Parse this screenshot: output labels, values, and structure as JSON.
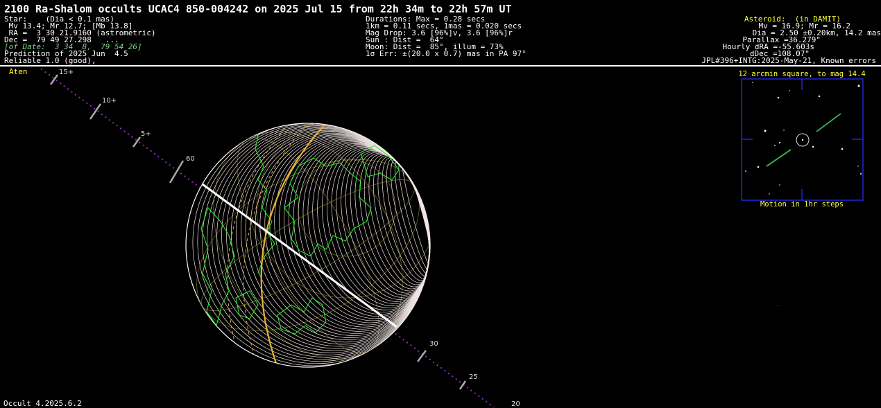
{
  "title": "2100 Ra-Shalom occults UCAC4 850-004242 on 2025 Jul 15 from 22h 34m to 22h 57m UT",
  "star_block": [
    "Star:    (Dia < 0.1 mas)",
    " Mv 13.4; Mr 12.7; [Mb 13.8]",
    " RA =  3 30 21.9160 (astrometric)",
    "Dec =  79 49 27.298   ...",
    "[of Date:  3 34  8,  79 54 26]",
    "Prediction of 2025 Jun  4.5",
    "Reliable 1.0 (good),"
  ],
  "event_block": [
    "Durations: Max = 0.28 secs",
    "1km = 0.11 secs, 1mas = 0.020 secs",
    "Mag Drop: 3.6 [96%]v, 3.6 [96%]r",
    "Sun : Dist =  64°",
    "Moon: Dist =  85°, illum = 73%",
    "1σ Err: ±(20.0 x 0.7) mas in PA 97°"
  ],
  "asteroid_block": {
    "header": "Asteroid:  (in DAMIT)",
    "lines": [
      "Mv = 16.9; Mr = 16.2",
      "Dia = 2.50 ±0.20km, 14.2 mas",
      "Parallax =36.279\"",
      "Hourly dRA =-55.603s",
      "dDec =108.07\"",
      "JPL#396+INTG:2025-May-21, Known errors"
    ]
  },
  "orbit_class": "Aten",
  "path_labels": [
    "15+",
    "10+",
    "5+",
    "60",
    "30",
    "25",
    "20"
  ],
  "finder": {
    "title": "12 arcmin square, to mag 14.4",
    "caption": "Motion in 1hr steps"
  },
  "footer": "Occult 4.2025.6.2",
  "colors": {
    "title": "#ffffff",
    "highlight": "#ffff33",
    "coastline": "#22ee22",
    "shadow": "#ffffff",
    "track": "#9933cc",
    "finder_border": "#2222dd",
    "motion": "#33aa55"
  }
}
